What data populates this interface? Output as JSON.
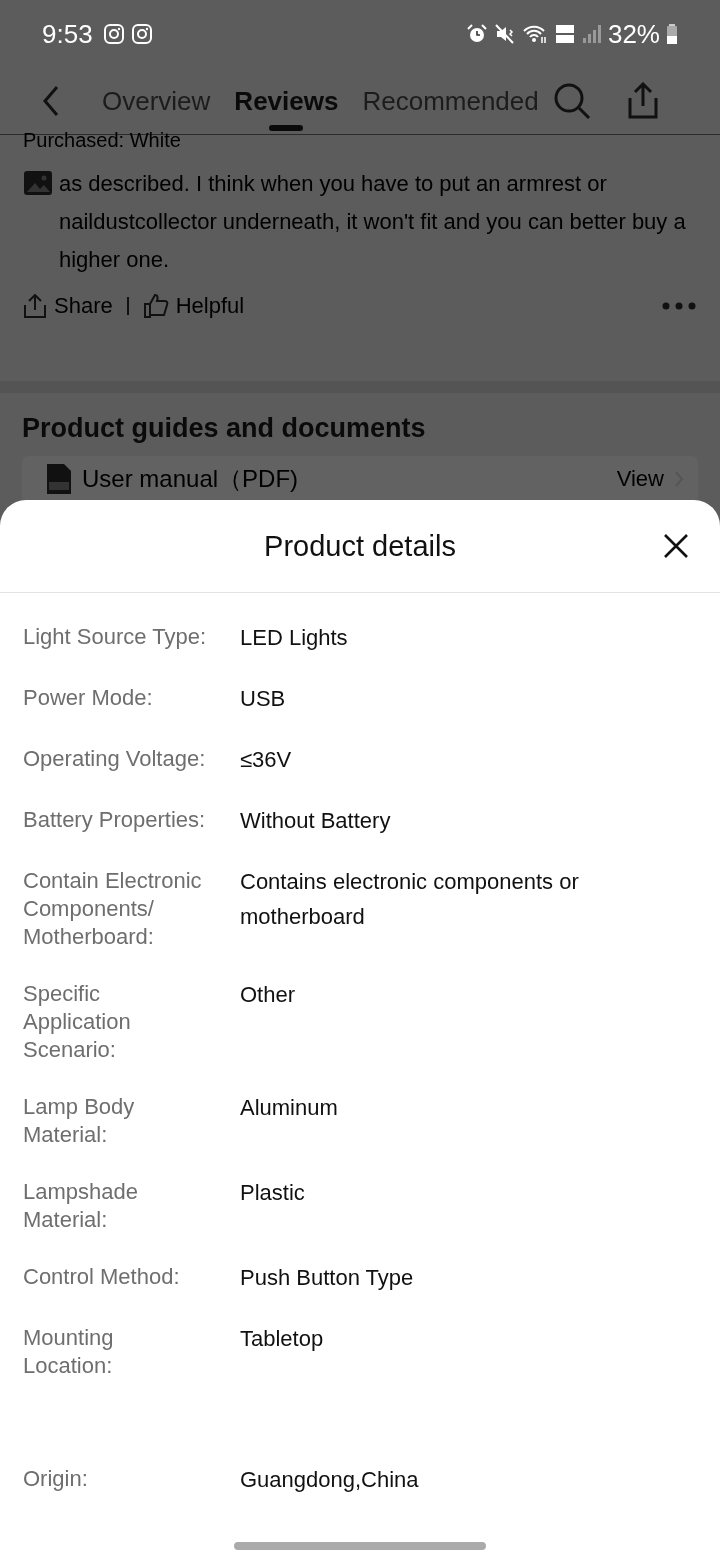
{
  "status_bar": {
    "time": "9:53",
    "battery": "32%"
  },
  "nav": {
    "tabs": [
      {
        "label": "Overview",
        "selected": false
      },
      {
        "label": "Reviews",
        "selected": true
      },
      {
        "label": "Recommended",
        "selected": false
      }
    ]
  },
  "review": {
    "purchased": "Purchased: White",
    "text": "as described. I think when you have to put an armrest or naildustcollector underneath, it won't fit and you can better buy a higher one.",
    "actions": [
      "Share",
      "Helpful"
    ]
  },
  "guides": {
    "title": "Product guides and documents",
    "document": "User manual（PDF)",
    "action": "View"
  },
  "sheet": {
    "title": "Product details",
    "rows": [
      {
        "label": "Light Source Type:",
        "value": "LED Lights"
      },
      {
        "label": "Power Mode:",
        "value": "USB"
      },
      {
        "label": "Operating Voltage:",
        "value": "≤36V"
      },
      {
        "label": "Battery Properties:",
        "value": "Without Battery"
      },
      {
        "label": "Contain Electronic Components/ Motherboard:",
        "value": "Contains electronic components or motherboard"
      },
      {
        "label": "Specific Application Scenario:",
        "value": "Other"
      },
      {
        "label": "Lamp Body Material:",
        "value": "Aluminum"
      },
      {
        "label": "Lampshade Material:",
        "value": "Plastic"
      },
      {
        "label": "Control Method:",
        "value": "Push Button Type"
      },
      {
        "label": "Mounting Location:",
        "value": "Tabletop"
      },
      {
        "label": "Origin:",
        "value": "Guangdong,China"
      }
    ]
  }
}
